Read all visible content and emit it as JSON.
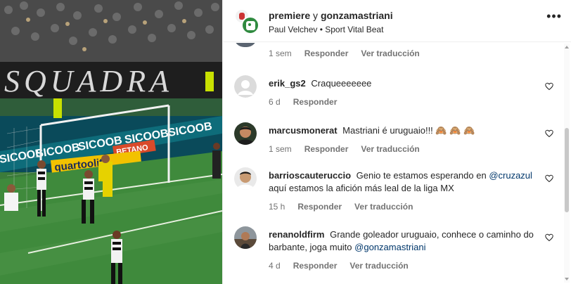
{
  "media": {
    "ads": [
      "SICOOB",
      "SICOOB",
      "SICOOB",
      "SICOOB",
      "SICOOB"
    ],
    "bet_sign": "BETANO",
    "quartos_sign": "quartoolit",
    "stands_banner": "SQUADRA"
  },
  "header": {
    "user1": "premiere",
    "joiner": "y",
    "user2": "gonzamastriani",
    "subtitle": "Paul Velchev • Sport Vital Beat"
  },
  "partial_comment": {
    "time": "1 sem",
    "reply": "Responder",
    "translate": "Ver traducción"
  },
  "comments": [
    {
      "username": "erik_gs2",
      "text": "Craqueeeeeee",
      "time": "6 d",
      "reply": "Responder",
      "translate": "",
      "avatar": "default-avatar"
    },
    {
      "username": "marcusmonerat",
      "text": "Mastriani é uruguaio!!! 🙈 🙈 🙈",
      "time": "1 sem",
      "reply": "Responder",
      "translate": "Ver traducción",
      "avatar": "user-photo"
    },
    {
      "username": "barrioscauteruccio",
      "text_before": "Genio te estamos esperando en",
      "mention": "@cruzazul",
      "text_after": "aquí estamos la afición más leal de la liga MX",
      "time": "15 h",
      "reply": "Responder",
      "translate": "Ver traducción",
      "avatar": "user-photo"
    },
    {
      "username": "renanoldfirm",
      "text_before": "Grande goleador uruguaio, conhece o caminho do barbante, joga muito",
      "mention": "@gonzamastriani",
      "text_after": "",
      "time": "4 d",
      "reply": "Responder",
      "translate": "Ver traducción",
      "avatar": "user-photo"
    }
  ],
  "icons": {
    "like": "heart-icon",
    "more": "more-options-icon"
  },
  "colors": {
    "mention": "#00376b",
    "muted": "#737373",
    "text": "#262626",
    "pitch": "#3b7b3a"
  }
}
